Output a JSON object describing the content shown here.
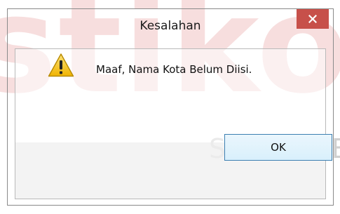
{
  "watermark": {
    "brand_text": "stikom",
    "sub_text": "SURAB"
  },
  "dialog": {
    "title": "Kesalahan",
    "close_icon": "close-icon",
    "message_icon": "warning-icon",
    "message": "Maaf, Nama Kota Belum Diisi.",
    "ok_label": "OK"
  },
  "colors": {
    "close_button": "#c7504a",
    "ok_border": "#3c7fb1",
    "warning_fill": "#f5c21b"
  }
}
